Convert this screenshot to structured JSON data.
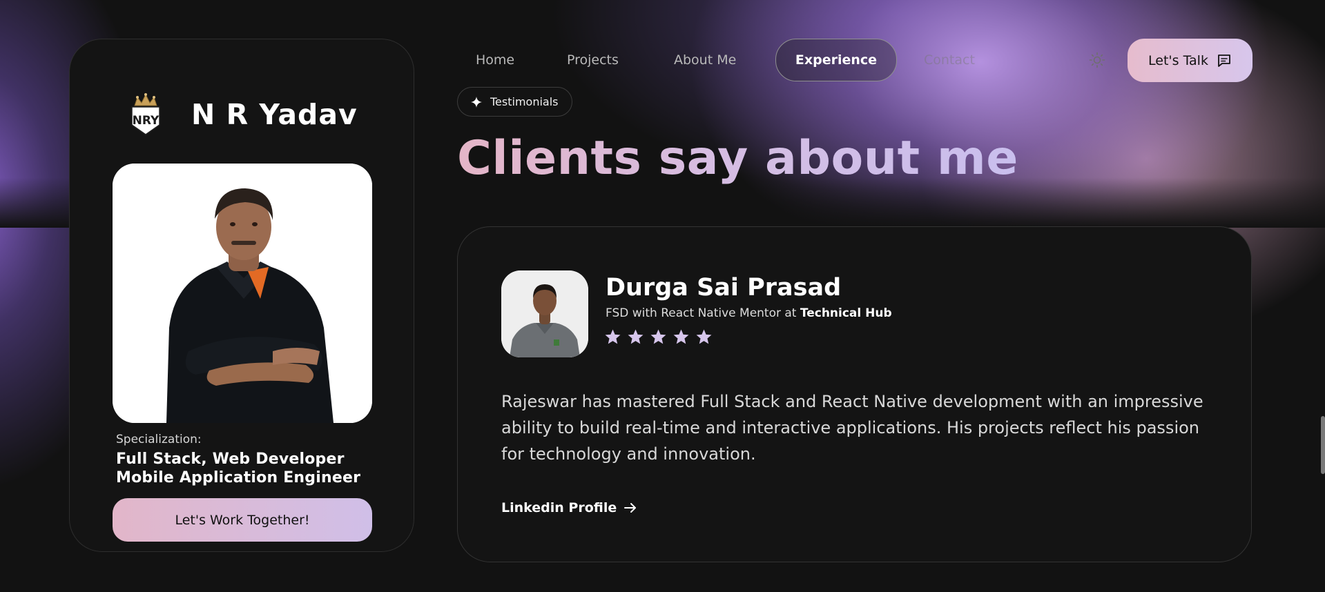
{
  "profile": {
    "logo_icon": "nry-crown-logo-icon",
    "name": "N R Yadav",
    "photo_icon": "profile-photo",
    "specialization_label": "Specialization:",
    "specialization_line1": "Full Stack, Web Developer",
    "specialization_line2": "Mobile Application Engineer",
    "cta_label": "Let's Work Together!"
  },
  "nav": {
    "items": [
      {
        "label": "Home"
      },
      {
        "label": "Projects"
      },
      {
        "label": "About Me"
      },
      {
        "label": "Experience"
      },
      {
        "label": "Contact"
      }
    ],
    "active": "Experience",
    "theme_icon": "sun-icon",
    "talk_label": "Let's Talk",
    "talk_icon": "chat-icon"
  },
  "section": {
    "pill_icon": "sparkle-icon",
    "pill_label": "Testimonials",
    "title": "Clients say about me"
  },
  "testimonial": {
    "name": "Durga Sai Prasad",
    "role_prefix": "FSD with React Native Mentor at",
    "company": "Technical Hub",
    "rating": 5,
    "rating_max": 5,
    "quote": "Rajeswar has mastered Full Stack and React Native development with an impressive ability to build real-time and interactive applications. His projects reflect his passion for technology and innovation.",
    "link_label": "Linkedin Profile",
    "link_icon": "arrow-right-icon"
  },
  "colors": {
    "background": "#121212",
    "card": "#141414",
    "accent_pink": "#e2b6c9",
    "accent_lavender": "#d0bfe8",
    "glow_purple": "#a98ad8",
    "star": "#d7c6ec"
  }
}
